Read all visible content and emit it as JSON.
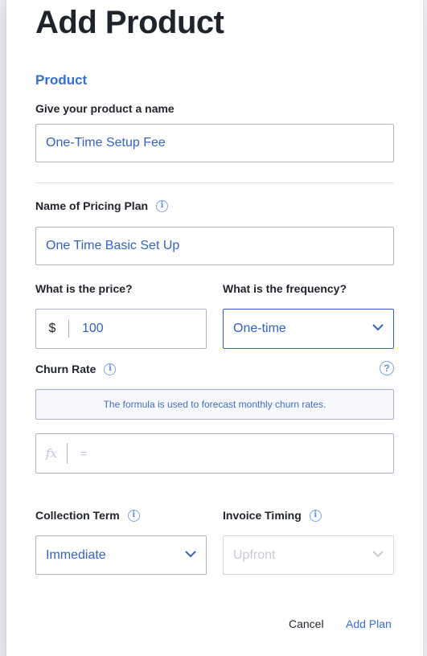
{
  "modal": {
    "title": "Add Product",
    "section_title": "Product",
    "product_name": {
      "label": "Give your product a name",
      "value": "One-Time Setup Fee"
    },
    "pricing_plan": {
      "label": "Name of Pricing Plan",
      "value": "One Time Basic Set Up"
    },
    "price": {
      "label": "What is the price?",
      "currency": "$",
      "value": "100"
    },
    "frequency": {
      "label": "What is the frequency?",
      "value": "One-time"
    },
    "churn": {
      "label": "Churn Rate",
      "note": "The formula is used to forecast monthly churn rates.",
      "fx_symbol": "fx",
      "formula": "="
    },
    "collection_term": {
      "label": "Collection Term",
      "value": "Immediate"
    },
    "invoice_timing": {
      "label": "Invoice Timing",
      "value": "Upfront"
    },
    "buttons": {
      "cancel": "Cancel",
      "add_plan": "Add Plan"
    }
  },
  "icons": {
    "info": "i",
    "help": "?"
  },
  "colors": {
    "accent": "#2f6fe0",
    "field_text": "#2f63c8",
    "border": "#a8b3c7",
    "disabled_text": "#c6cbd4"
  }
}
